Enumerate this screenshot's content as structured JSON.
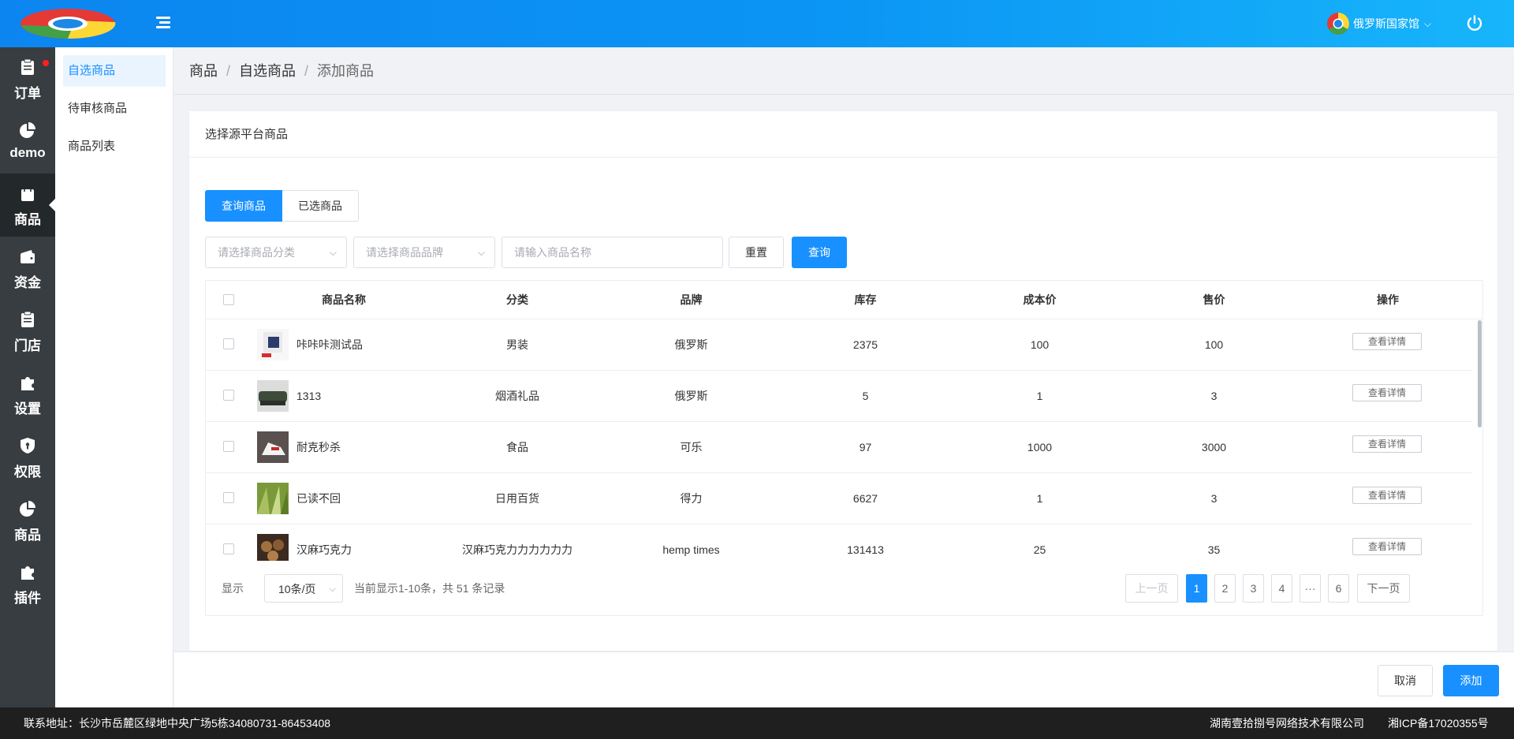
{
  "header": {
    "user_name": "俄罗斯国家馆",
    "chevron": "⌵"
  },
  "colors": {
    "primary": "#1890ff",
    "nav_dark": "#373d41",
    "nav_active": "#23282b",
    "header_gradient_start": "#0c85f0",
    "header_gradient_end": "#17b5fb",
    "notification_dot": "#ff1f1f",
    "footer": "#1f1f1f"
  },
  "left_nav": {
    "items": [
      {
        "label": "订单",
        "icon": "clipboard-icon",
        "badge_dot": true
      },
      {
        "label": "demo",
        "icon": "pie-chart-icon"
      },
      {
        "label": "商品",
        "icon": "shopping-bag-icon",
        "active": true
      },
      {
        "label": "资金",
        "icon": "wallet-icon"
      },
      {
        "label": "门店",
        "icon": "clipboard-icon"
      },
      {
        "label": "设置",
        "icon": "puzzle-icon"
      },
      {
        "label": "权限",
        "icon": "shield-icon"
      },
      {
        "label": "商品",
        "icon": "pie-chart-icon"
      },
      {
        "label": "插件",
        "icon": "puzzle-icon"
      }
    ]
  },
  "sub_nav": {
    "items": [
      {
        "label": "自选商品",
        "active": true
      },
      {
        "label": "待审核商品"
      },
      {
        "label": "商品列表"
      }
    ]
  },
  "breadcrumb": {
    "items": [
      "商品",
      "自选商品",
      "添加商品"
    ],
    "separator": "/"
  },
  "card": {
    "title": "选择源平台商品"
  },
  "tabs": [
    {
      "label": "查询商品",
      "active": true
    },
    {
      "label": "已选商品"
    }
  ],
  "filters": {
    "category_placeholder": "请选择商品分类",
    "brand_placeholder": "请选择商品品牌",
    "name_placeholder": "请输入商品名称",
    "reset_label": "重置",
    "search_label": "查询"
  },
  "table": {
    "columns": [
      "商品名称",
      "分类",
      "品牌",
      "库存",
      "成本价",
      "售价",
      "操作"
    ],
    "rows": [
      {
        "name": "咔咔咔测试品",
        "category": "男装",
        "brand": "俄罗斯",
        "stock": "2375",
        "cost": "100",
        "price": "100",
        "action": "查看详情"
      },
      {
        "name": "1313",
        "category": "烟酒礼品",
        "brand": "俄罗斯",
        "stock": "5",
        "cost": "1",
        "price": "3",
        "action": "查看详情"
      },
      {
        "name": "耐克秒杀",
        "category": "食品",
        "brand": "可乐",
        "stock": "97",
        "cost": "1000",
        "price": "3000",
        "action": "查看详情"
      },
      {
        "name": "已读不回",
        "category": "日用百货",
        "brand": "得力",
        "stock": "6627",
        "cost": "1",
        "price": "3",
        "action": "查看详情"
      },
      {
        "name": "汉麻巧克力",
        "category": "汉麻巧克力力力力力力",
        "brand": "hemp times",
        "stock": "131413",
        "cost": "25",
        "price": "35",
        "action": "查看详情"
      }
    ]
  },
  "pagination": {
    "show_label": "显示",
    "page_size": "10条/页",
    "summary": "当前显示1-10条，共 51 条记录",
    "prev_label": "上一页",
    "next_label": "下一页",
    "pages": [
      "1",
      "2",
      "3",
      "4",
      "···",
      "6"
    ],
    "current": "1"
  },
  "actions": {
    "cancel_label": "取消",
    "add_label": "添加"
  },
  "footer": {
    "address": "联系地址：长沙市岳麓区绿地中央广场5栋34080731-86453408",
    "company": "湖南壹拾捌号网络技术有限公司",
    "icp": "湘ICP备17020355号"
  }
}
